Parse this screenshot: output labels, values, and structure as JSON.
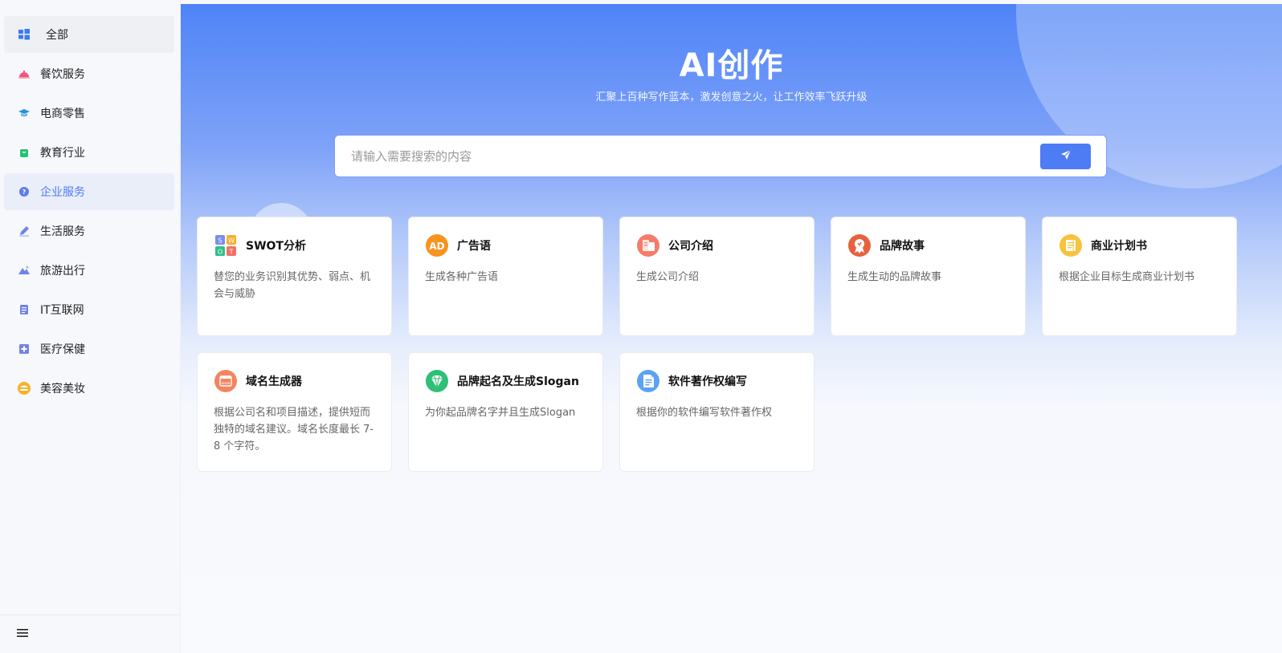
{
  "sidebar": {
    "items": [
      {
        "label": "全部",
        "icon": "windows-grid-icon"
      },
      {
        "label": "餐饮服务",
        "icon": "cloche-icon"
      },
      {
        "label": "电商零售",
        "icon": "graduation-cap-icon"
      },
      {
        "label": "教育行业",
        "icon": "shopping-bag-icon"
      },
      {
        "label": "企业服务",
        "icon": "help-circle-icon"
      },
      {
        "label": "生活服务",
        "icon": "pen-icon"
      },
      {
        "label": "旅游出行",
        "icon": "mountain-icon"
      },
      {
        "label": "IT互联网",
        "icon": "document-list-icon"
      },
      {
        "label": "医疗保健",
        "icon": "hospital-icon"
      },
      {
        "label": "美容美妆",
        "icon": "beauty-icon"
      }
    ],
    "active_index": 4,
    "menu_icon": "hamburger-menu-icon"
  },
  "hero": {
    "title": "AI创作",
    "subtitle": "汇聚上百种写作蓝本，激发创意之火，让工作效率飞跃升级"
  },
  "search": {
    "placeholder": "请输入需要搜索的内容",
    "value": "",
    "button_icon": "send-icon"
  },
  "cards": [
    {
      "title": "SWOT分析",
      "desc": "替您的业务识别其优势、弱点、机会与威胁",
      "icon": "swot-grid-icon"
    },
    {
      "title": "广告语",
      "desc": "生成各种广告语",
      "icon": "ad-badge-icon"
    },
    {
      "title": "公司介绍",
      "desc": "生成公司介绍",
      "icon": "company-building-icon"
    },
    {
      "title": "品牌故事",
      "desc": "生成生动的品牌故事",
      "icon": "award-medal-icon"
    },
    {
      "title": "商业计划书",
      "desc": "根据企业目标生成商业计划书",
      "icon": "business-plan-icon"
    },
    {
      "title": "域名生成器",
      "desc": "根据公司名和项目描述，提供短而独特的域名建议。域名长度最长 7-8 个字符。",
      "icon": "domain-www-icon"
    },
    {
      "title": "品牌起名及生成Slogan",
      "desc": "为你起品牌名字并且生成Slogan",
      "icon": "diamond-icon"
    },
    {
      "title": "软件著作权编写",
      "desc": "根据你的软件编写软件著作权",
      "icon": "document-icon"
    }
  ],
  "colors": {
    "accent": "#4d7cf5",
    "hero_top": "#4f84f7",
    "active_bg": "#eaeef9"
  }
}
